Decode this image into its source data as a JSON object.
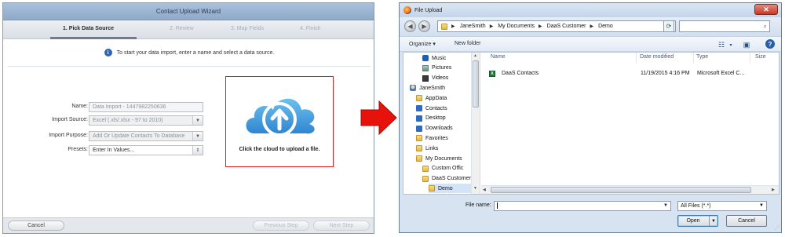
{
  "wizard": {
    "title": "Contact Upload Wizard",
    "steps": [
      {
        "label": "1. Pick Data Source"
      },
      {
        "label": "2. Review"
      },
      {
        "label": "3. Map Fields"
      },
      {
        "label": "4. Finish"
      }
    ],
    "active_step": 1,
    "info_text": "To start your data import, enter a name and select a data source.",
    "fields": {
      "name": {
        "label": "Name:",
        "value": "Data Import - 1447982250636"
      },
      "import_source": {
        "label": "Import Source:",
        "value": "Excel (.xls/.xlsx - 97 to 2010)"
      },
      "import_purpose": {
        "label": "Import Purpose:",
        "value": "Add Or Update Contacts To Database"
      },
      "presets": {
        "label": "Presets:",
        "value": "Enter In Values..."
      }
    },
    "upload_hint": "Click the cloud to upload a file.",
    "buttons": {
      "cancel": "Cancel",
      "previous": "Previous Step",
      "next": "Next Step"
    },
    "colors": {
      "cloud": "#4aa3e0",
      "highlight_border": "#d9201e",
      "title_bar": "#9cb6d5"
    }
  },
  "arrow": {
    "color": "#e8120c"
  },
  "dialog": {
    "title": "File Upload",
    "close": "✕",
    "breadcrumb": [
      "JaneSmith",
      "My Documents",
      "DaaS Customer",
      "Demo"
    ],
    "search_placeholder": "",
    "toolbar": {
      "organize": "Organize",
      "new_folder": "New folder"
    },
    "nav_items": [
      {
        "label": "Music",
        "icon": "music"
      },
      {
        "label": "Pictures",
        "icon": "pic"
      },
      {
        "label": "Videos",
        "icon": "vid"
      },
      {
        "label": "JaneSmith",
        "icon": "user"
      },
      {
        "label": "AppData",
        "icon": "folder"
      },
      {
        "label": "Contacts",
        "icon": "blue"
      },
      {
        "label": "Desktop",
        "icon": "blue"
      },
      {
        "label": "Downloads",
        "icon": "blue"
      },
      {
        "label": "Favorites",
        "icon": "folder"
      },
      {
        "label": "Links",
        "icon": "folder"
      },
      {
        "label": "My Documents",
        "icon": "folder"
      },
      {
        "label": "Custom Offic",
        "icon": "folder"
      },
      {
        "label": "DaaS Customer",
        "icon": "folder"
      },
      {
        "label": "Demo",
        "icon": "folder"
      }
    ],
    "columns": {
      "name": "Name",
      "date": "Date modified",
      "type": "Type",
      "size": "Size"
    },
    "files": [
      {
        "name": "DaaS Contacts",
        "date": "11/19/2015 4:16 PM",
        "type": "Microsoft Excel C...",
        "size": ""
      }
    ],
    "filename_label": "File name:",
    "filename_value": "",
    "filetype": "All Files (*.*)",
    "buttons": {
      "open": "Open",
      "cancel": "Cancel"
    }
  }
}
